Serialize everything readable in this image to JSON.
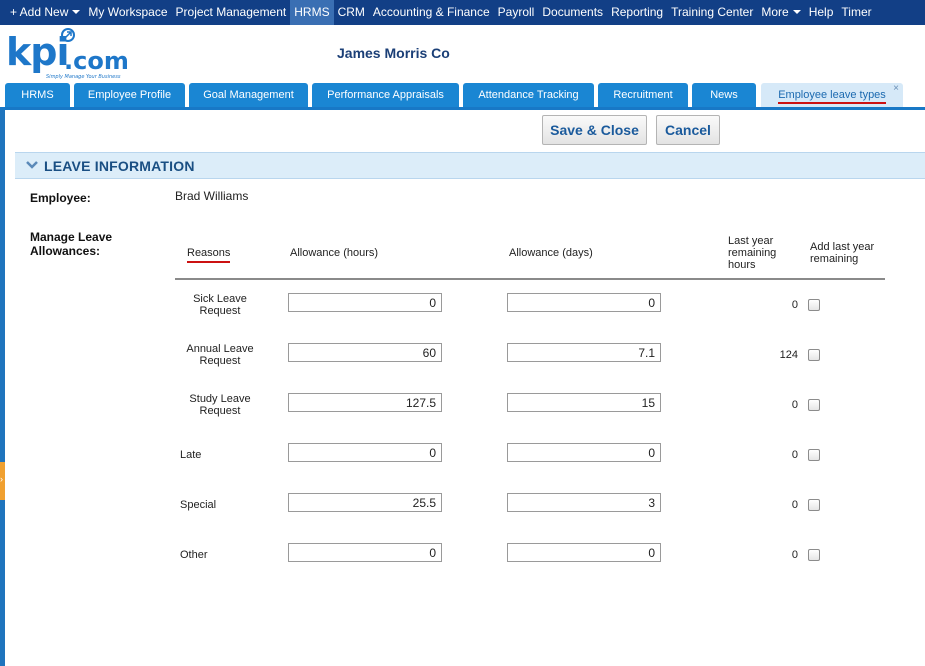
{
  "topnav": {
    "items": [
      {
        "label": "+ Add New",
        "dropdown": true
      },
      {
        "label": "My Workspace",
        "dropdown": false
      },
      {
        "label": "Project Management",
        "dropdown": false
      },
      {
        "label": "HRMS",
        "dropdown": false,
        "active": true
      },
      {
        "label": "CRM",
        "dropdown": false
      },
      {
        "label": "Accounting & Finance",
        "dropdown": false
      },
      {
        "label": "Payroll",
        "dropdown": false
      },
      {
        "label": "Documents",
        "dropdown": false
      },
      {
        "label": "Reporting",
        "dropdown": false
      },
      {
        "label": "Training Center",
        "dropdown": false
      },
      {
        "label": "More",
        "dropdown": true
      },
      {
        "label": "Help",
        "dropdown": false
      },
      {
        "label": "Timer",
        "dropdown": false
      }
    ]
  },
  "header": {
    "logo_text": "kpi.com",
    "logo_tagline": "Simply Manage Your Business",
    "company_name": "James Morris Co"
  },
  "tabs": [
    {
      "label": "HRMS"
    },
    {
      "label": "Employee Profile"
    },
    {
      "label": "Goal Management"
    },
    {
      "label": "Performance Appraisals"
    },
    {
      "label": "Attendance Tracking"
    },
    {
      "label": "Recruitment"
    },
    {
      "label": "News"
    },
    {
      "label": "Employee leave types",
      "active": true,
      "close": "×"
    }
  ],
  "toolbar": {
    "save_close_label": "Save & Close",
    "cancel_label": "Cancel"
  },
  "section": {
    "title": "LEAVE INFORMATION"
  },
  "form": {
    "employee_label": "Employee:",
    "employee_value": "Brad Williams",
    "manage_label_1": "Manage Leave",
    "manage_label_2": "Allowances:"
  },
  "table": {
    "headers": {
      "reasons": "Reasons",
      "allowance_hours": "Allowance (hours)",
      "allowance_days": "Allowance (days)",
      "last_year_1": "Last year",
      "last_year_2": "remaining",
      "last_year_3": "hours",
      "add_last_year_1": "Add last year",
      "add_last_year_2": "remaining"
    },
    "rows": [
      {
        "reason_1": "Sick Leave",
        "reason_2": "Request",
        "hours": "0",
        "days": "0",
        "remaining": "0",
        "checked": false
      },
      {
        "reason_1": "Annual Leave",
        "reason_2": "Request",
        "hours": "60",
        "days": "7.1",
        "remaining": "124",
        "checked": false
      },
      {
        "reason_1": "Study Leave",
        "reason_2": "Request",
        "hours": "127.5",
        "days": "15",
        "remaining": "0",
        "checked": false
      },
      {
        "reason_1": "Late",
        "reason_2": "",
        "hours": "0",
        "days": "0",
        "remaining": "0",
        "checked": false
      },
      {
        "reason_1": "Special",
        "reason_2": "",
        "hours": "25.5",
        "days": "3",
        "remaining": "0",
        "checked": false
      },
      {
        "reason_1": "Other",
        "reason_2": "",
        "hours": "0",
        "days": "0",
        "remaining": "0",
        "checked": false
      }
    ]
  },
  "colors": {
    "topnav_bg": "#123f86",
    "tab_bg": "#1a86d3",
    "tab_active_bg": "#d6e9f8",
    "accent_red": "#cc1111",
    "section_bg": "#dcedf9"
  }
}
